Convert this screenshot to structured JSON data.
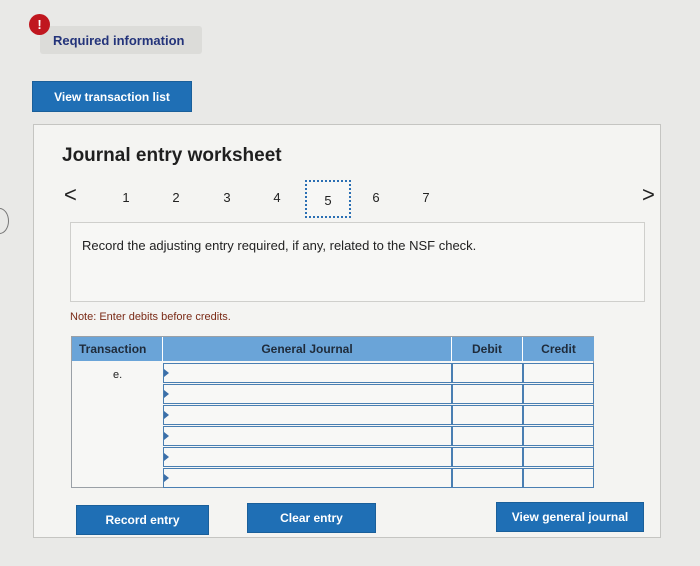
{
  "alert": {
    "icon": "exclamation-circle-icon",
    "text": "Required information"
  },
  "buttons": {
    "view_transaction_list": "View transaction list",
    "record_entry": "Record entry",
    "clear_entry": "Clear entry",
    "view_general_journal": "View general journal"
  },
  "worksheet": {
    "title": "Journal entry worksheet",
    "prev_icon": "chevron-left-icon",
    "next_icon": "chevron-right-icon",
    "prev_glyph": "<",
    "next_glyph": ">",
    "steps": [
      "1",
      "2",
      "3",
      "4",
      "5",
      "6",
      "7"
    ],
    "active_step": "5",
    "instruction": "Record the adjusting entry required, if any, related to the NSF check.",
    "note": "Note: Enter debits before credits."
  },
  "journal": {
    "headers": {
      "transaction": "Transaction",
      "account": "General Journal",
      "debit": "Debit",
      "credit": "Credit"
    },
    "rows": [
      {
        "transaction": "e.",
        "account": "",
        "debit": "",
        "credit": ""
      },
      {
        "transaction": "",
        "account": "",
        "debit": "",
        "credit": ""
      },
      {
        "transaction": "",
        "account": "",
        "debit": "",
        "credit": ""
      },
      {
        "transaction": "",
        "account": "",
        "debit": "",
        "credit": ""
      },
      {
        "transaction": "",
        "account": "",
        "debit": "",
        "credit": ""
      },
      {
        "transaction": "",
        "account": "",
        "debit": "",
        "credit": ""
      }
    ]
  },
  "colors": {
    "primary_button": "#1f6fb5",
    "table_header": "#6aa4d8",
    "alert": "#c0171f"
  }
}
